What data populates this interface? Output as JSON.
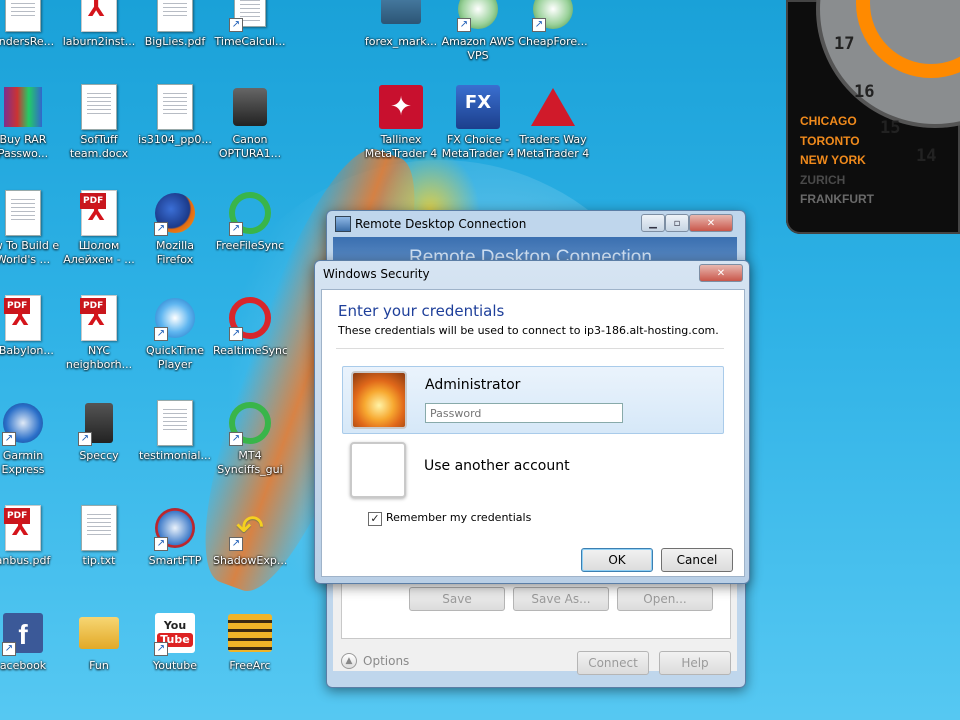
{
  "desktop_icons": [
    {
      "label": "undersRe...",
      "kind": "doc"
    },
    {
      "label": "laburn2inst...",
      "kind": "pdf"
    },
    {
      "label": "BigLies.pdf",
      "kind": "doc"
    },
    {
      "label": "TimeCalcul...",
      "kind": "app"
    },
    {
      "label": "forex_mark...",
      "kind": "app"
    },
    {
      "label": "Amazon AWS VPS",
      "kind": "rdp"
    },
    {
      "label": "CheapFore...",
      "kind": "rdp"
    },
    {
      "label": "Buy RAR Passwo...",
      "kind": "winrar"
    },
    {
      "label": "SofTuff team.docx",
      "kind": "word"
    },
    {
      "label": "is3104_pp0...",
      "kind": "doc"
    },
    {
      "label": "Canon OPTURA1...",
      "kind": "camera"
    },
    {
      "label": "Tallinex MetaTrader 4",
      "kind": "tallinex"
    },
    {
      "label": "FX Choice - MetaTrader 4",
      "kind": "fxchoice"
    },
    {
      "label": "Traders Way MetaTrader 4",
      "kind": "tradersway"
    },
    {
      "label": "ow To Build e World's ...",
      "kind": "doc"
    },
    {
      "label": "Шолом Алейхем - ...",
      "kind": "pdf"
    },
    {
      "label": "Mozilla Firefox",
      "kind": "firefox"
    },
    {
      "label": "FreeFileSync",
      "kind": "sync"
    },
    {
      "label": "eBabylon...",
      "kind": "pdf"
    },
    {
      "label": "NYC neighborh...",
      "kind": "pdf"
    },
    {
      "label": "QuickTime Player",
      "kind": "quicktime"
    },
    {
      "label": "RealtimeSync",
      "kind": "sync_red"
    },
    {
      "label": "Garmin Express",
      "kind": "garmin"
    },
    {
      "label": "Speccy",
      "kind": "speccy"
    },
    {
      "label": "testimonial...",
      "kind": "word"
    },
    {
      "label": "MT4 Synciffs_gui",
      "kind": "sync"
    },
    {
      "label": "anbus.pdf",
      "kind": "pdf"
    },
    {
      "label": "tip.txt",
      "kind": "doc"
    },
    {
      "label": "SmartFTP",
      "kind": "smartftp"
    },
    {
      "label": "ShadowExp...",
      "kind": "shadow"
    },
    {
      "label": "acebook",
      "kind": "facebook"
    },
    {
      "label": "Fun",
      "kind": "folder"
    },
    {
      "label": "Youtube",
      "kind": "youtube"
    },
    {
      "label": "FreeArc",
      "kind": "freearc"
    }
  ],
  "clock_widget": {
    "dial_numbers": [
      "17",
      "16",
      "15",
      "14"
    ],
    "cities": [
      {
        "name": "CHICAGO",
        "color": "#f08a1c"
      },
      {
        "name": "TORONTO",
        "color": "#f08a1c"
      },
      {
        "name": "NEW YORK",
        "color": "#f08a1c"
      },
      {
        "name": "ZURICH",
        "color": "#4a4a4a"
      },
      {
        "name": "FRANKFURT",
        "color": "#6a6a6a"
      }
    ]
  },
  "rdc_window": {
    "title": "Remote Desktop Connection",
    "banner_text": "Remote Desktop Connection",
    "save_label": "Save",
    "save_as_label": "Save As...",
    "open_label": "Open...",
    "options_label": "Options",
    "connect_label": "Connect",
    "help_label": "Help"
  },
  "security_dialog": {
    "title": "Windows Security",
    "heading": "Enter your credentials",
    "subtext": "These credentials will be used to connect to ip3-186.alt-hosting.com.",
    "account_name": "Administrator",
    "password_placeholder": "Password",
    "another_account_label": "Use another account",
    "remember_label": "Remember my credentials",
    "remember_checked": true,
    "ok_label": "OK",
    "cancel_label": "Cancel",
    "close_glyph": "✕"
  },
  "colors": {
    "heading_blue": "#1e3f9a",
    "desktop_blue": "#2fb2e6",
    "orange_accent": "#f08a1c"
  }
}
